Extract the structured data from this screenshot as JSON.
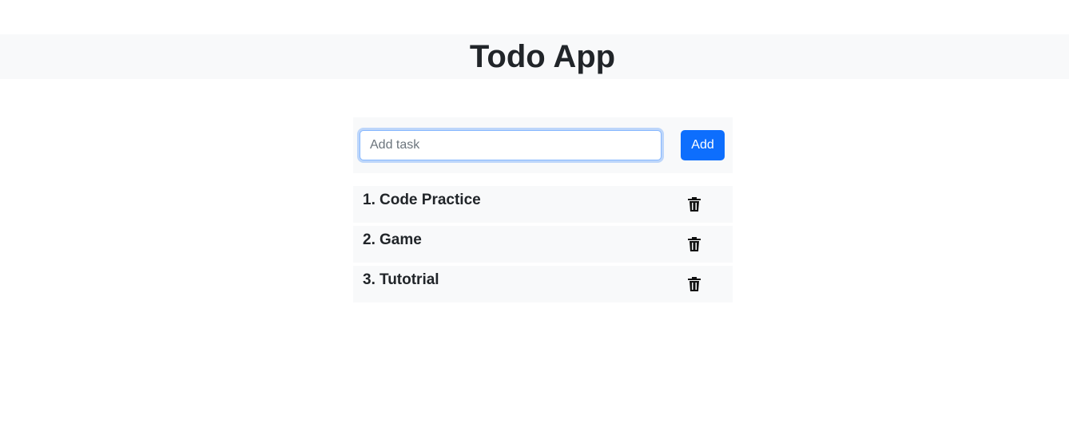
{
  "header": {
    "title": "Todo App"
  },
  "form": {
    "input_value": "",
    "input_placeholder": "Add task",
    "add_label": "Add"
  },
  "tasks": [
    {
      "number": "1.",
      "text": "Code Practice",
      "icon": "trash-icon"
    },
    {
      "number": "2.",
      "text": "Game",
      "icon": "trash-icon"
    },
    {
      "number": "3.",
      "text": "Tutotrial",
      "icon": "trash-icon"
    }
  ],
  "colors": {
    "header_bg": "#f8f9fa",
    "primary": "#0d6efd",
    "text": "#212529"
  }
}
